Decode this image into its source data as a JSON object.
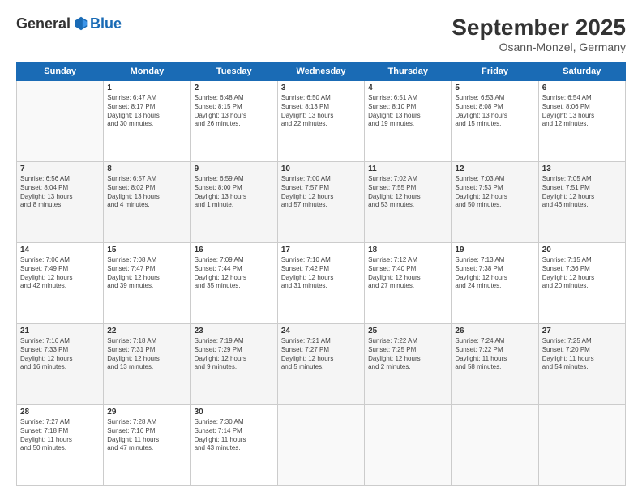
{
  "logo": {
    "general": "General",
    "blue": "Blue"
  },
  "header": {
    "month": "September 2025",
    "location": "Osann-Monzel, Germany"
  },
  "days": [
    "Sunday",
    "Monday",
    "Tuesday",
    "Wednesday",
    "Thursday",
    "Friday",
    "Saturday"
  ],
  "weeks": [
    [
      {
        "num": "",
        "info": ""
      },
      {
        "num": "1",
        "info": "Sunrise: 6:47 AM\nSunset: 8:17 PM\nDaylight: 13 hours\nand 30 minutes."
      },
      {
        "num": "2",
        "info": "Sunrise: 6:48 AM\nSunset: 8:15 PM\nDaylight: 13 hours\nand 26 minutes."
      },
      {
        "num": "3",
        "info": "Sunrise: 6:50 AM\nSunset: 8:13 PM\nDaylight: 13 hours\nand 22 minutes."
      },
      {
        "num": "4",
        "info": "Sunrise: 6:51 AM\nSunset: 8:10 PM\nDaylight: 13 hours\nand 19 minutes."
      },
      {
        "num": "5",
        "info": "Sunrise: 6:53 AM\nSunset: 8:08 PM\nDaylight: 13 hours\nand 15 minutes."
      },
      {
        "num": "6",
        "info": "Sunrise: 6:54 AM\nSunset: 8:06 PM\nDaylight: 13 hours\nand 12 minutes."
      }
    ],
    [
      {
        "num": "7",
        "info": "Sunrise: 6:56 AM\nSunset: 8:04 PM\nDaylight: 13 hours\nand 8 minutes."
      },
      {
        "num": "8",
        "info": "Sunrise: 6:57 AM\nSunset: 8:02 PM\nDaylight: 13 hours\nand 4 minutes."
      },
      {
        "num": "9",
        "info": "Sunrise: 6:59 AM\nSunset: 8:00 PM\nDaylight: 13 hours\nand 1 minute."
      },
      {
        "num": "10",
        "info": "Sunrise: 7:00 AM\nSunset: 7:57 PM\nDaylight: 12 hours\nand 57 minutes."
      },
      {
        "num": "11",
        "info": "Sunrise: 7:02 AM\nSunset: 7:55 PM\nDaylight: 12 hours\nand 53 minutes."
      },
      {
        "num": "12",
        "info": "Sunrise: 7:03 AM\nSunset: 7:53 PM\nDaylight: 12 hours\nand 50 minutes."
      },
      {
        "num": "13",
        "info": "Sunrise: 7:05 AM\nSunset: 7:51 PM\nDaylight: 12 hours\nand 46 minutes."
      }
    ],
    [
      {
        "num": "14",
        "info": "Sunrise: 7:06 AM\nSunset: 7:49 PM\nDaylight: 12 hours\nand 42 minutes."
      },
      {
        "num": "15",
        "info": "Sunrise: 7:08 AM\nSunset: 7:47 PM\nDaylight: 12 hours\nand 39 minutes."
      },
      {
        "num": "16",
        "info": "Sunrise: 7:09 AM\nSunset: 7:44 PM\nDaylight: 12 hours\nand 35 minutes."
      },
      {
        "num": "17",
        "info": "Sunrise: 7:10 AM\nSunset: 7:42 PM\nDaylight: 12 hours\nand 31 minutes."
      },
      {
        "num": "18",
        "info": "Sunrise: 7:12 AM\nSunset: 7:40 PM\nDaylight: 12 hours\nand 27 minutes."
      },
      {
        "num": "19",
        "info": "Sunrise: 7:13 AM\nSunset: 7:38 PM\nDaylight: 12 hours\nand 24 minutes."
      },
      {
        "num": "20",
        "info": "Sunrise: 7:15 AM\nSunset: 7:36 PM\nDaylight: 12 hours\nand 20 minutes."
      }
    ],
    [
      {
        "num": "21",
        "info": "Sunrise: 7:16 AM\nSunset: 7:33 PM\nDaylight: 12 hours\nand 16 minutes."
      },
      {
        "num": "22",
        "info": "Sunrise: 7:18 AM\nSunset: 7:31 PM\nDaylight: 12 hours\nand 13 minutes."
      },
      {
        "num": "23",
        "info": "Sunrise: 7:19 AM\nSunset: 7:29 PM\nDaylight: 12 hours\nand 9 minutes."
      },
      {
        "num": "24",
        "info": "Sunrise: 7:21 AM\nSunset: 7:27 PM\nDaylight: 12 hours\nand 5 minutes."
      },
      {
        "num": "25",
        "info": "Sunrise: 7:22 AM\nSunset: 7:25 PM\nDaylight: 12 hours\nand 2 minutes."
      },
      {
        "num": "26",
        "info": "Sunrise: 7:24 AM\nSunset: 7:22 PM\nDaylight: 11 hours\nand 58 minutes."
      },
      {
        "num": "27",
        "info": "Sunrise: 7:25 AM\nSunset: 7:20 PM\nDaylight: 11 hours\nand 54 minutes."
      }
    ],
    [
      {
        "num": "28",
        "info": "Sunrise: 7:27 AM\nSunset: 7:18 PM\nDaylight: 11 hours\nand 50 minutes."
      },
      {
        "num": "29",
        "info": "Sunrise: 7:28 AM\nSunset: 7:16 PM\nDaylight: 11 hours\nand 47 minutes."
      },
      {
        "num": "30",
        "info": "Sunrise: 7:30 AM\nSunset: 7:14 PM\nDaylight: 11 hours\nand 43 minutes."
      },
      {
        "num": "",
        "info": ""
      },
      {
        "num": "",
        "info": ""
      },
      {
        "num": "",
        "info": ""
      },
      {
        "num": "",
        "info": ""
      }
    ]
  ]
}
